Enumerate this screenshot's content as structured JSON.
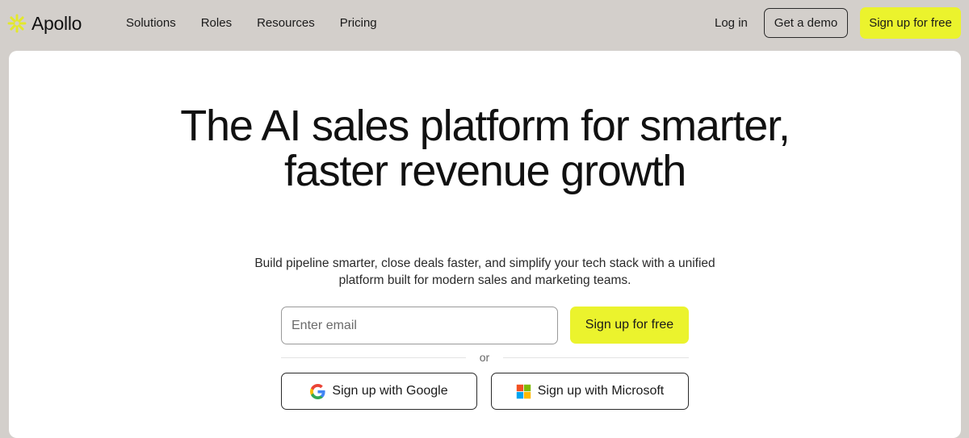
{
  "header": {
    "logo_text": "Apollo",
    "logo_icon": "apollo-asterisk-logo",
    "nav": [
      "Solutions",
      "Roles",
      "Resources",
      "Pricing"
    ],
    "login_label": "Log in",
    "demo_label": "Get a demo",
    "signup_label": "Sign up for free"
  },
  "hero": {
    "title": "The AI sales platform for smarter, faster revenue growth",
    "subtitle": "Build pipeline smarter, close deals faster, and simplify your tech stack with a unified platform built for modern sales and marketing teams.",
    "email_placeholder": "Enter email",
    "email_value": "",
    "signup_label": "Sign up for free",
    "divider_text": "or",
    "google_label": "Sign up with Google",
    "google_icon": "google-icon",
    "microsoft_label": "Sign up with Microsoft",
    "microsoft_icon": "microsoft-icon"
  },
  "colors": {
    "page_background": "#d3cfcb",
    "accent": "#ebf32d",
    "card_background": "#ffffff",
    "text": "#111111"
  }
}
